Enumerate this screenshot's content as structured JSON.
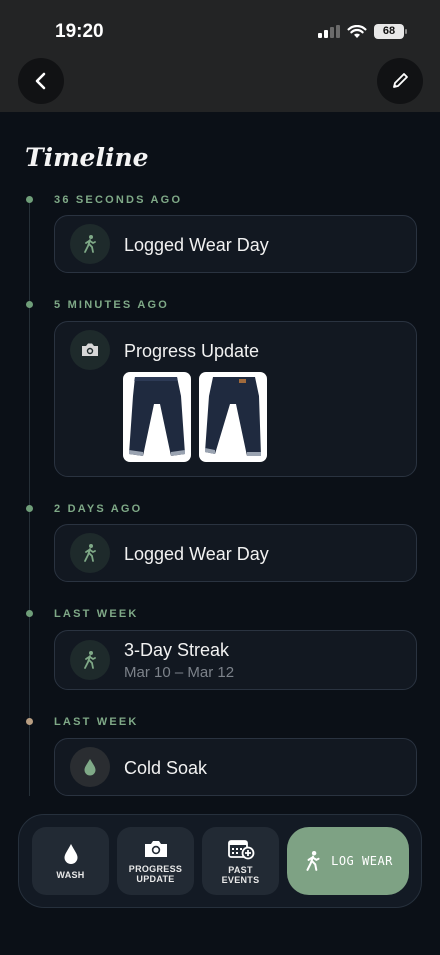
{
  "status_bar": {
    "time": "19:20",
    "battery": "68"
  },
  "header": {
    "back_icon": "chevron-left-icon",
    "edit_icon": "pencil-icon"
  },
  "page_title": "Timeline",
  "entries": [
    {
      "time": "36 SECONDS AGO",
      "title": "Logged Wear Day",
      "icon": "walking-person-icon"
    },
    {
      "time": "5 MINUTES AGO",
      "title": "Progress Update",
      "icon": "camera-icon",
      "photos": [
        "jeans-front-photo",
        "jeans-back-photo"
      ]
    },
    {
      "time": "2 DAYS AGO",
      "title": "Logged Wear Day",
      "icon": "walking-person-icon"
    },
    {
      "time": "LAST WEEK",
      "title": "3-Day Streak",
      "subtitle": "Mar 10 – Mar 12",
      "icon": "walking-person-icon"
    },
    {
      "time": "LAST WEEK",
      "title": "Cold Soak",
      "icon": "water-drop-icon"
    }
  ],
  "bottom_bar": {
    "wash": "WASH",
    "progress_update_line1": "PROGRESS",
    "progress_update_line2": "UPDATE",
    "past_events_line1": "PAST",
    "past_events_line2": "EVENTS",
    "log_wear": "LOG WEAR"
  },
  "colors": {
    "background": "#0b1017",
    "accent_green": "#7ea284",
    "label_green": "#7fa987",
    "card": "#121821"
  }
}
